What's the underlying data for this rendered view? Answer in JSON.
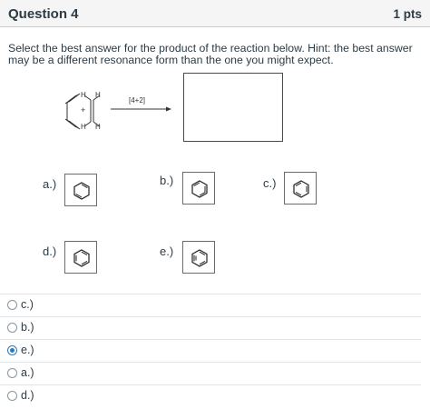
{
  "header": {
    "title": "Question 4",
    "points": "1 pts"
  },
  "prompt": "Select the best answer for the product of the reaction below. Hint: the best answer may be a different resonance form than the one you might expect.",
  "reaction": {
    "condition": "[4+2]",
    "plus": "+",
    "h_label": "H"
  },
  "options": [
    {
      "label": "a.)",
      "structure": "cyclohexa-1,4-diene"
    },
    {
      "label": "b.)",
      "structure": "cyclohexadiene-allene"
    },
    {
      "label": "c.)",
      "structure": "benzene"
    },
    {
      "label": "d.)",
      "structure": "benzene"
    },
    {
      "label": "e.)",
      "structure": "cyclohexatriene-with-triple-bond"
    }
  ],
  "answers": [
    {
      "text": "c.)",
      "selected": false
    },
    {
      "text": "b.)",
      "selected": false
    },
    {
      "text": "e.)",
      "selected": true
    },
    {
      "text": "a.)",
      "selected": false
    },
    {
      "text": "d.)",
      "selected": false
    }
  ],
  "colors": {
    "accent": "#2b7abc",
    "header_bg": "#f5f5f5",
    "text": "#2d3b45"
  }
}
